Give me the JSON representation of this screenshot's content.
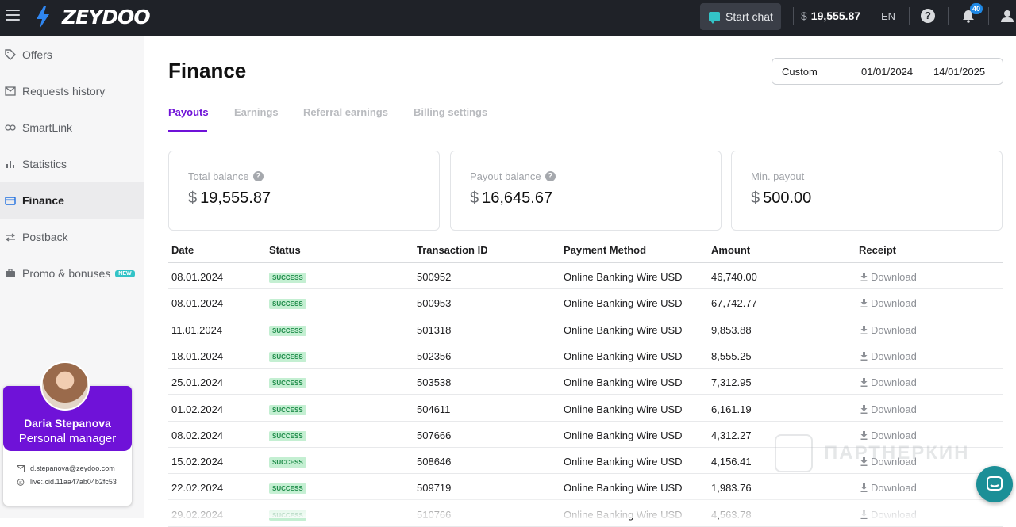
{
  "header": {
    "logo_text": "ZEYDOO",
    "start_chat_label": "Start chat",
    "balance_currency": "$",
    "balance_value": "19,555.87",
    "language": "EN",
    "notifications_count": "40",
    "icons": {
      "menu": "hamburger-menu-icon",
      "logo": "lightning-bolt-icon",
      "chat": "chat-bubble-icon",
      "help": "help-circle-icon",
      "bell": "bell-icon",
      "user": "user-icon"
    }
  },
  "sidebar": {
    "items": [
      {
        "label": "Offers",
        "icon": "tag-icon",
        "active": false
      },
      {
        "label": "Requests history",
        "icon": "mail-icon",
        "active": false
      },
      {
        "label": "SmartLink",
        "icon": "link-icon",
        "active": false
      },
      {
        "label": "Statistics",
        "icon": "bar-chart-icon",
        "active": false
      },
      {
        "label": "Finance",
        "icon": "card-icon",
        "active": true
      },
      {
        "label": "Postback",
        "icon": "arrows-icon",
        "active": false
      },
      {
        "label": "Promo & bonuses",
        "icon": "briefcase-icon",
        "active": false,
        "badge": "NEW"
      }
    ],
    "manager": {
      "name": "Daria Stepanova",
      "role": "Personal manager",
      "email": "d.stepanova@zeydoo.com",
      "skype": "live:.cid.11aa47ab04b2fc53"
    }
  },
  "page": {
    "title": "Finance",
    "date_range": {
      "preset": "Custom",
      "from": "01/01/2024",
      "separator": "–",
      "to": "14/01/2025"
    },
    "tabs": [
      {
        "label": "Payouts",
        "active": true
      },
      {
        "label": "Earnings",
        "active": false
      },
      {
        "label": "Referral earnings",
        "active": false
      },
      {
        "label": "Billing settings",
        "active": false
      }
    ],
    "cards": [
      {
        "label": "Total balance",
        "currency": "$",
        "value": "19,555.87",
        "has_help": true
      },
      {
        "label": "Payout balance",
        "currency": "$",
        "value": "16,645.67",
        "has_help": true
      },
      {
        "label": "Min. payout",
        "currency": "$",
        "value": "500.00",
        "has_help": false
      }
    ],
    "table": {
      "columns": [
        "Date",
        "Status",
        "Transaction ID",
        "Payment Method",
        "Amount",
        "Receipt"
      ],
      "rows": [
        {
          "date": "08.01.2024",
          "status": "SUCCESS",
          "id": "500952",
          "method": "Online Banking Wire USD",
          "amount": "46,740.00",
          "receipt": "Download"
        },
        {
          "date": "08.01.2024",
          "status": "SUCCESS",
          "id": "500953",
          "method": "Online Banking Wire USD",
          "amount": "67,742.77",
          "receipt": "Download"
        },
        {
          "date": "11.01.2024",
          "status": "SUCCESS",
          "id": "501318",
          "method": "Online Banking Wire USD",
          "amount": "9,853.88",
          "receipt": "Download"
        },
        {
          "date": "18.01.2024",
          "status": "SUCCESS",
          "id": "502356",
          "method": "Online Banking Wire USD",
          "amount": "8,555.25",
          "receipt": "Download"
        },
        {
          "date": "25.01.2024",
          "status": "SUCCESS",
          "id": "503538",
          "method": "Online Banking Wire USD",
          "amount": "7,312.95",
          "receipt": "Download"
        },
        {
          "date": "01.02.2024",
          "status": "SUCCESS",
          "id": "504611",
          "method": "Online Banking Wire USD",
          "amount": "6,161.19",
          "receipt": "Download"
        },
        {
          "date": "08.02.2024",
          "status": "SUCCESS",
          "id": "507666",
          "method": "Online Banking Wire USD",
          "amount": "4,312.27",
          "receipt": "Download"
        },
        {
          "date": "15.02.2024",
          "status": "SUCCESS",
          "id": "508646",
          "method": "Online Banking Wire USD",
          "amount": "4,156.41",
          "receipt": "Download"
        },
        {
          "date": "22.02.2024",
          "status": "SUCCESS",
          "id": "509719",
          "method": "Online Banking Wire USD",
          "amount": "1,983.76",
          "receipt": "Download"
        },
        {
          "date": "29.02.2024",
          "status": "SUCCESS",
          "id": "510766",
          "method": "Online Banking Wire USD",
          "amount": "4,563.78",
          "receipt": "Download"
        }
      ]
    }
  },
  "watermark": {
    "text": "ПАРТНЕРКИН"
  },
  "colors": {
    "topbar": "#1f2228",
    "accent": "#6f12d8",
    "chat_accent": "#33c3c7",
    "success_bg": "#c4efd2",
    "success_text": "#1f8c4a",
    "fab": "#1b8f97"
  }
}
